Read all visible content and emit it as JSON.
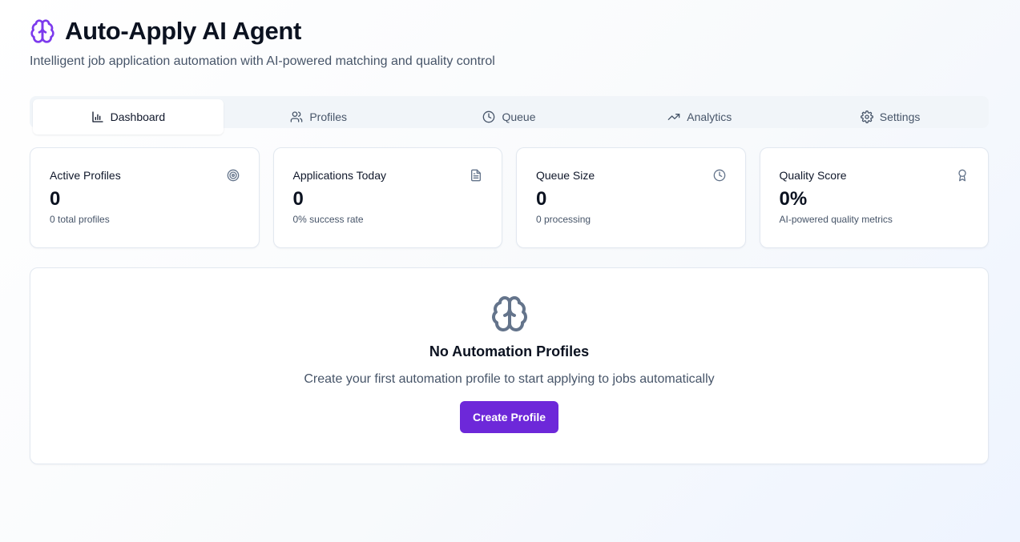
{
  "header": {
    "title": "Auto-Apply AI Agent",
    "subtitle": "Intelligent job application automation with AI-powered matching and quality control",
    "logo_icon": "brain-icon",
    "accent_color": "#7c3aed"
  },
  "tabs": [
    {
      "label": "Dashboard",
      "icon": "bar-chart-icon",
      "active": true
    },
    {
      "label": "Profiles",
      "icon": "users-icon",
      "active": false
    },
    {
      "label": "Queue",
      "icon": "clock-icon",
      "active": false
    },
    {
      "label": "Analytics",
      "icon": "trending-up-icon",
      "active": false
    },
    {
      "label": "Settings",
      "icon": "gear-icon",
      "active": false
    }
  ],
  "stats": [
    {
      "title": "Active Profiles",
      "value": "0",
      "sub": "0 total profiles",
      "icon": "target-icon"
    },
    {
      "title": "Applications Today",
      "value": "0",
      "sub": "0% success rate",
      "icon": "file-text-icon"
    },
    {
      "title": "Queue Size",
      "value": "0",
      "sub": "0 processing",
      "icon": "clock-icon"
    },
    {
      "title": "Quality Score",
      "value": "0%",
      "sub": "AI-powered quality metrics",
      "icon": "award-icon"
    }
  ],
  "empty_state": {
    "icon": "brain-icon",
    "title": "No Automation Profiles",
    "message": "Create your first automation profile to start applying to jobs automatically",
    "button_label": "Create Profile",
    "button_color": "#6d28d9"
  }
}
